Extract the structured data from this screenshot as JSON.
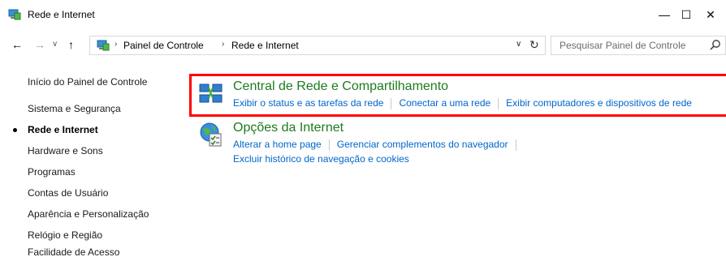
{
  "window": {
    "title": "Rede e Internet",
    "minimize_glyph": "—",
    "maximize_glyph": "☐",
    "close_glyph": "✕"
  },
  "navigation": {
    "back_glyph": "←",
    "forward_glyph": "→",
    "recent_glyph": "∨",
    "up_glyph": "↑",
    "breadcrumbs": [
      "Painel de Controle",
      "Rede e Internet"
    ],
    "separator_glyph": "›",
    "dropdown_glyph": "∨",
    "refresh_glyph": "↻"
  },
  "search": {
    "placeholder": "Pesquisar Painel de Controle"
  },
  "sidebar": {
    "items": [
      {
        "label": "Início do Painel de Controle",
        "active": false
      },
      {
        "label": "Sistema e Segurança",
        "active": false
      },
      {
        "label": "Rede e Internet",
        "active": true
      },
      {
        "label": "Hardware e Sons",
        "active": false
      },
      {
        "label": "Programas",
        "active": false
      },
      {
        "label": "Contas de Usuário",
        "active": false
      },
      {
        "label": "Aparência e Personalização",
        "active": false
      },
      {
        "label": "Relógio e Região",
        "active": false
      },
      {
        "label": "Facilidade de Acesso",
        "active": false
      }
    ]
  },
  "main": {
    "categories": [
      {
        "title": "Central de Rede e Compartilhamento",
        "icon": "network-sharing-icon",
        "highlighted": true,
        "links": [
          "Exibir o status e as tarefas da rede",
          "Conectar a uma rede",
          "Exibir computadores e dispositivos de rede"
        ]
      },
      {
        "title": "Opções da Internet",
        "icon": "internet-options-icon",
        "highlighted": false,
        "links": [
          "Alterar a home page",
          "Gerenciar complementos do navegador",
          "Excluir histórico de navegação e cookies"
        ]
      }
    ]
  },
  "colors": {
    "category_title": "#1e7b1e",
    "link": "#0066cc",
    "highlight": "#ff0000"
  }
}
